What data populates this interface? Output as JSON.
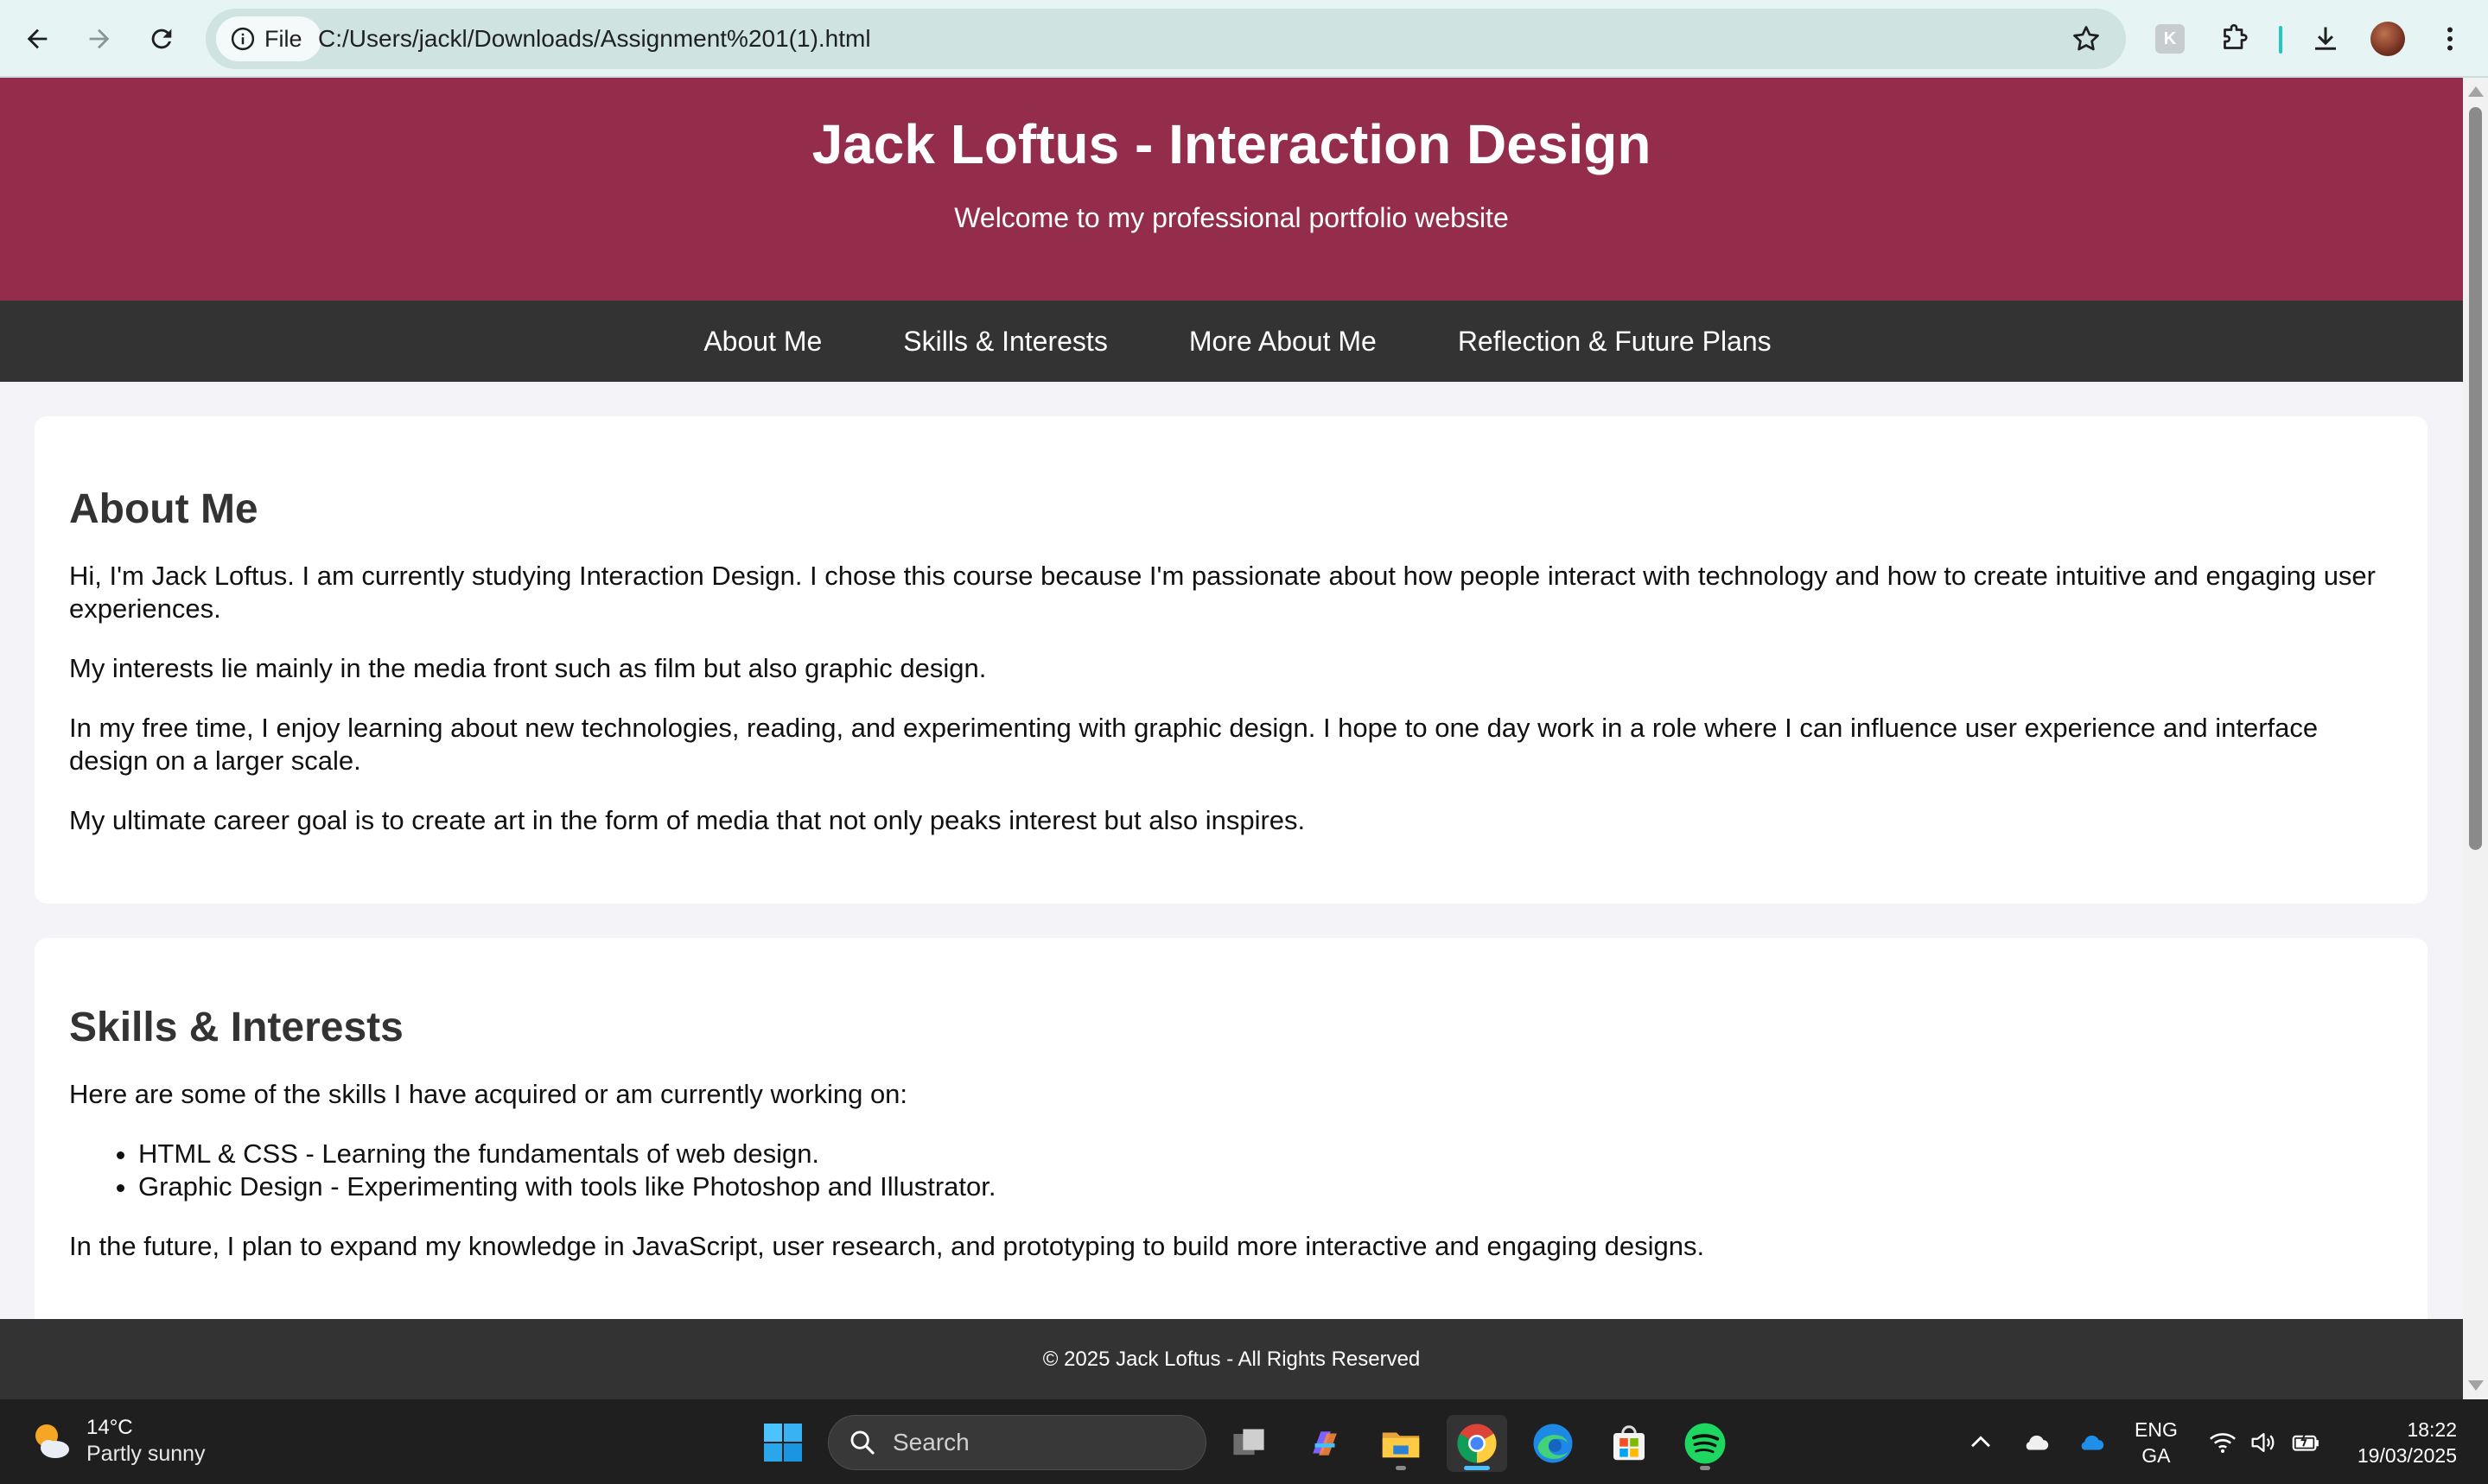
{
  "browser": {
    "site_info_label": "File",
    "url": "C:/Users/jackl/Downloads/Assignment%201(1).html",
    "extension_badge": "K"
  },
  "header": {
    "title": "Jack Loftus - Interaction Design",
    "subtitle": "Welcome to my professional portfolio website"
  },
  "nav": {
    "items": [
      {
        "label": "About Me"
      },
      {
        "label": "Skills & Interests"
      },
      {
        "label": "More About Me"
      },
      {
        "label": "Reflection & Future Plans"
      }
    ]
  },
  "about": {
    "heading": "About Me",
    "paragraphs": [
      "Hi, I'm Jack Loftus. I am currently studying Interaction Design. I chose this course because I'm passionate about how people interact with technology and how to create intuitive and engaging user experiences.",
      "My interests lie mainly in the media front such as film but also graphic design.",
      "In my free time, I enjoy learning about new technologies, reading, and experimenting with graphic design. I hope to one day work in a role where I can influence user experience and interface design on a larger scale.",
      "My ultimate career goal is to create art in the form of media that not only peaks interest but also inspires."
    ]
  },
  "skills": {
    "heading": "Skills & Interests",
    "intro": "Here are some of the skills I have acquired or am currently working on:",
    "items": [
      "HTML & CSS - Learning the fundamentals of web design.",
      "Graphic Design - Experimenting with tools like Photoshop and Illustrator."
    ],
    "outro": "In the future, I plan to expand my knowledge in JavaScript, user research, and prototyping to build more interactive and engaging designs."
  },
  "footer": {
    "text": "© 2025 Jack Loftus - All Rights Reserved"
  },
  "taskbar": {
    "weather_temp": "14°C",
    "weather_desc": "Partly sunny",
    "search_label": "Search",
    "lang_primary": "ENG",
    "lang_secondary": "GA",
    "time": "18:22",
    "date": "19/03/2025"
  },
  "colors": {
    "header_bg": "#932d4b",
    "nav_bg": "#333333",
    "page_bg": "#f4f4f8",
    "browser_bar_bg": "#e6f5f4"
  }
}
